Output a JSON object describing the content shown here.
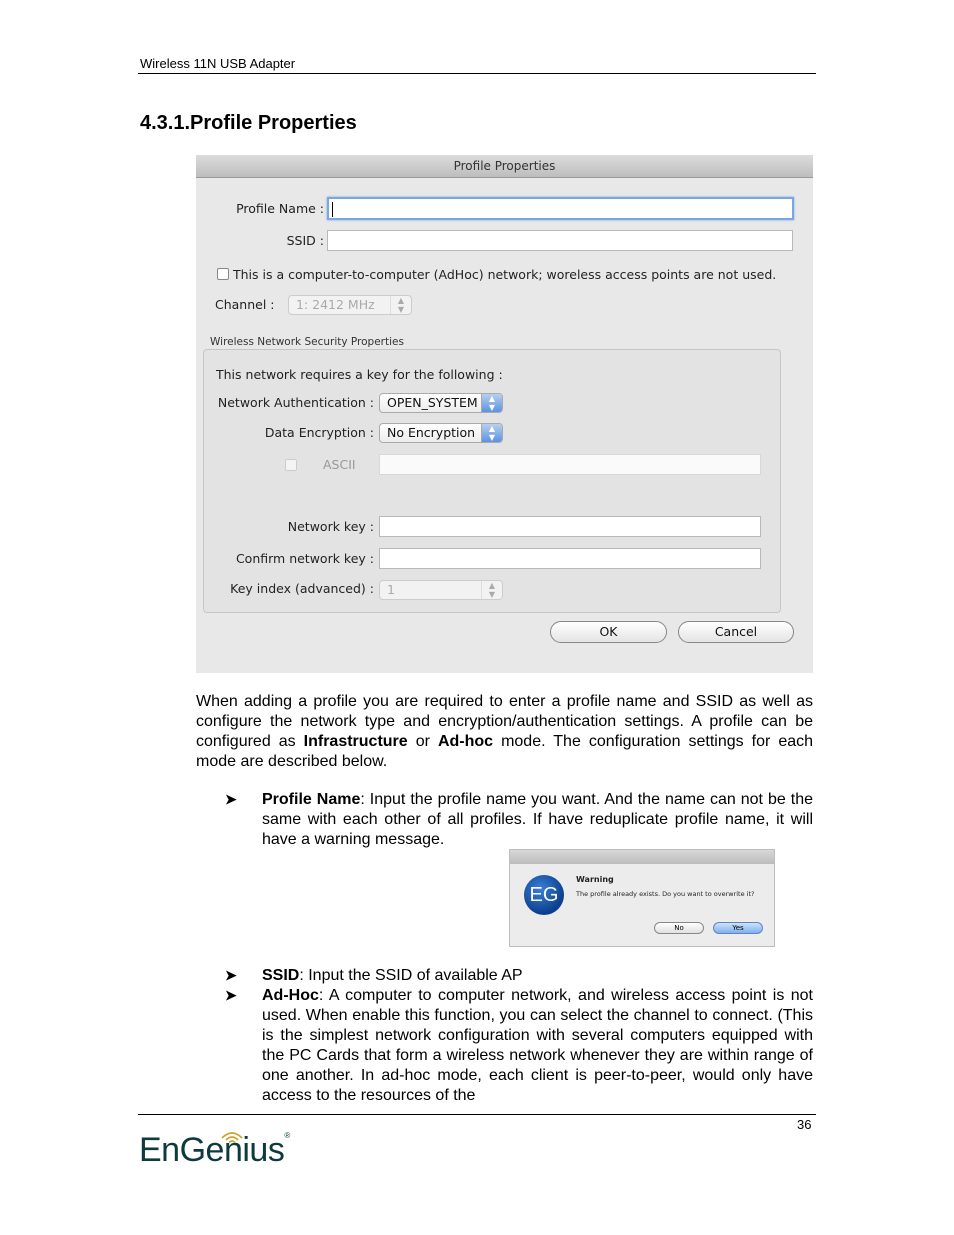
{
  "header": {
    "title": "Wireless 11N USB Adapter"
  },
  "section": {
    "title": "4.3.1.Profile Properties"
  },
  "dialog": {
    "title": "Profile Properties",
    "profile_name_label": "Profile Name :",
    "profile_name_value": "",
    "ssid_label": "SSID :",
    "ssid_value": "",
    "adhoc_checkbox_label": "This is a computer-to-computer (AdHoc) network; woreless access points are not used.",
    "adhoc_checked": false,
    "channel_label": "Channel :",
    "channel_value": "1: 2412 MHz",
    "security_group_title": "Wireless Network Security Properties",
    "requires_key_text": "This network requires a key for the following :",
    "auth_label": "Network Authentication :",
    "auth_value": "OPEN_SYSTEM",
    "encryption_label": "Data Encryption :",
    "encryption_value": "No Encryption",
    "ascii_label": "ASCII",
    "ascii_value": "",
    "network_key_label": "Network key :",
    "network_key_value": "",
    "confirm_key_label": "Confirm network key :",
    "confirm_key_value": "",
    "key_index_label": "Key index (advanced) :",
    "key_index_value": "1",
    "ok_label": "OK",
    "cancel_label": "Cancel"
  },
  "body": {
    "intro_1": "When adding a profile you are required to enter a profile name and SSID as well as configure the network type and encryption/authentication settings.  A profile can be configured as ",
    "intro_bold_1": "Infrastructure",
    "intro_2": " or ",
    "intro_bold_2": "Ad-hoc",
    "intro_3": " mode. The configuration settings for each mode are described below.",
    "bullet_glyph": "➤",
    "bullets": [
      {
        "term": "Profile Name",
        "text": ": Input the profile name you want. And the name can not be the same with each other of all profiles. If have reduplicate profile name, it will have a warning message."
      },
      {
        "term": "SSID",
        "text": ": Input the SSID of available AP"
      },
      {
        "term": "Ad-Hoc",
        "text": ": A computer to computer network, and wireless access point is not used. When enable this function, you can select the channel to connect. (This is the simplest network configuration with several computers equipped with the PC Cards that form a wireless network whenever they are within range of one another.  In ad-hoc mode, each client is peer-to-peer, would only have access to the resources of the"
      }
    ]
  },
  "warning": {
    "logo_text": "EG",
    "title": "Warning",
    "message": "The profile already exists. Do you want to overwrite it?",
    "no_label": "No",
    "yes_label": "Yes"
  },
  "footer": {
    "page_number": "36",
    "logo_text": "EnGenius",
    "logo_reg": "®"
  }
}
